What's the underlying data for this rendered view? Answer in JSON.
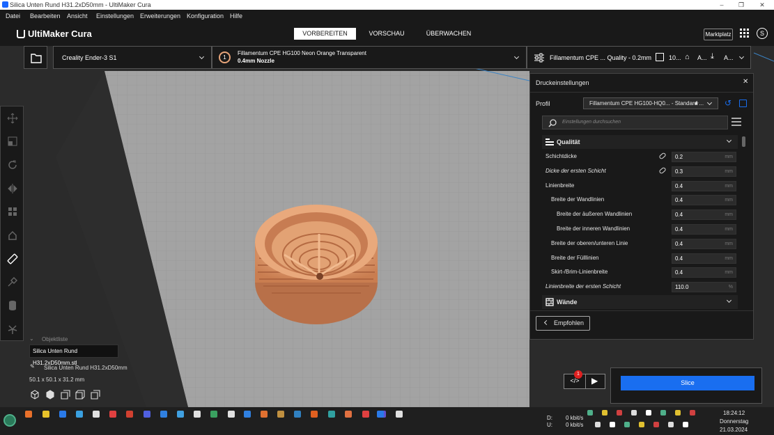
{
  "window": {
    "title": "Silica Unten Rund H31.2xD50mm - UltiMaker Cura",
    "controls": [
      "–",
      "❐",
      "✕"
    ]
  },
  "menu": [
    "Datei",
    "Bearbeiten",
    "Ansicht",
    "Einstellungen",
    "Erweiterungen",
    "Konfiguration",
    "Hilfe"
  ],
  "header": {
    "brand": "UltiMaker Cura",
    "stages": [
      {
        "label": "VORBEREITEN",
        "active": true
      },
      {
        "label": "VORSCHAU",
        "active": false
      },
      {
        "label": "ÜBERWACHEN",
        "active": false
      }
    ],
    "marketplace": "Marktplatz",
    "avatar_initial": "S"
  },
  "printer": {
    "name": "Creality Ender-3 S1"
  },
  "material": {
    "extruder_number": "1",
    "name": "Fillamentum CPE HG100 Neon Orange Transparent",
    "nozzle": "0.4mm Nozzle"
  },
  "quality_bar": {
    "summary": "Fillamentum CPE ... Quality - 0.2mm",
    "infill": "10...",
    "support": "A...",
    "adhesion": "A..."
  },
  "settings_panel": {
    "title": "Druckeinstellungen",
    "profile_label": "Profil",
    "profile_value": "Fillamentum CPE HG100-HQ0... - Standard ...",
    "search_placeholder": "Einstellungen durchsuchen",
    "section_quality": "Qualität",
    "section_walls": "Wände",
    "recommended_button": "Empfohlen",
    "rows": [
      {
        "label": "Schichtdicke",
        "value": "0.2",
        "unit": "mm",
        "indent": 0,
        "italic": false,
        "link": true
      },
      {
        "label": "Dicke der ersten Schicht",
        "value": "0.3",
        "unit": "mm",
        "indent": 0,
        "italic": true,
        "link": true
      },
      {
        "label": "Linienbreite",
        "value": "0.4",
        "unit": "mm",
        "indent": 0,
        "italic": false,
        "link": false
      },
      {
        "label": "Breite der Wandlinien",
        "value": "0.4",
        "unit": "mm",
        "indent": 1,
        "italic": false,
        "link": false
      },
      {
        "label": "Breite der äußeren Wandlinien",
        "value": "0.4",
        "unit": "mm",
        "indent": 2,
        "italic": false,
        "link": false
      },
      {
        "label": "Breite der inneren Wandlinien",
        "value": "0.4",
        "unit": "mm",
        "indent": 2,
        "italic": false,
        "link": false
      },
      {
        "label": "Breite der oberen/unteren Linie",
        "value": "0.4",
        "unit": "mm",
        "indent": 1,
        "italic": false,
        "link": false
      },
      {
        "label": "Breite der Fülllinien",
        "value": "0.4",
        "unit": "mm",
        "indent": 1,
        "italic": false,
        "link": false
      },
      {
        "label": "Skirt-/Brim-Linienbreite",
        "value": "0.4",
        "unit": "mm",
        "indent": 1,
        "italic": false,
        "link": false
      },
      {
        "label": "Linienbreite der ersten Schicht",
        "value": "110.0",
        "unit": "%",
        "indent": 0,
        "italic": true,
        "link": false
      }
    ]
  },
  "object_list": {
    "header": "Objektliste",
    "file": "Silica Unten Rund H31.2xD50mm.stl",
    "object_name": "Silica Unten Rund H31.2xD50mm",
    "dimensions": "50.1 x 50.1 x 31.2 mm"
  },
  "slice": {
    "button": "Slice",
    "badge": "1"
  },
  "taskbar": {
    "net_down_label": "D:",
    "net_up_label": "U:",
    "net_down": "0 kbit/s",
    "net_up": "0 kbit/s",
    "time": "18:24:12",
    "day": "Donnerstag",
    "date": "21.03.2024"
  },
  "colors": {
    "accent": "#196ef0",
    "model": "#e8a57a",
    "panel": "#191919",
    "plate": "#9a9a9a"
  }
}
